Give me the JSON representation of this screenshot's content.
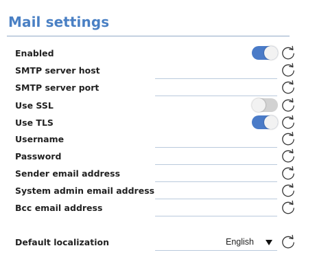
{
  "header": {
    "title": "Mail settings"
  },
  "fields": [
    {
      "id": "enabled",
      "label": "Enabled",
      "type": "toggle",
      "value": true
    },
    {
      "id": "smtp_host",
      "label": "SMTP server host",
      "type": "text",
      "value": ""
    },
    {
      "id": "smtp_port",
      "label": "SMTP server port",
      "type": "text",
      "value": ""
    },
    {
      "id": "use_ssl",
      "label": "Use SSL",
      "type": "toggle",
      "value": false
    },
    {
      "id": "use_tls",
      "label": "Use TLS",
      "type": "toggle",
      "value": true
    },
    {
      "id": "username",
      "label": "Username",
      "type": "text",
      "value": ""
    },
    {
      "id": "password",
      "label": "Password",
      "type": "text",
      "value": ""
    },
    {
      "id": "sender_email",
      "label": "Sender email address",
      "type": "text",
      "value": ""
    },
    {
      "id": "admin_email",
      "label": "System admin email address",
      "type": "text",
      "value": ""
    },
    {
      "id": "bcc_email",
      "label": "Bcc email address",
      "type": "text",
      "value": ""
    },
    {
      "id": "default_localization",
      "label": "Default localization",
      "type": "select",
      "value": "English"
    }
  ],
  "icons": {
    "reset": "reset-icon",
    "dropdown": "caret-down-icon"
  },
  "colors": {
    "accent": "#4a80c4",
    "toggle_on": "#4a7bc8",
    "toggle_off": "#d2d2d2",
    "rule": "#b9c9dc"
  }
}
